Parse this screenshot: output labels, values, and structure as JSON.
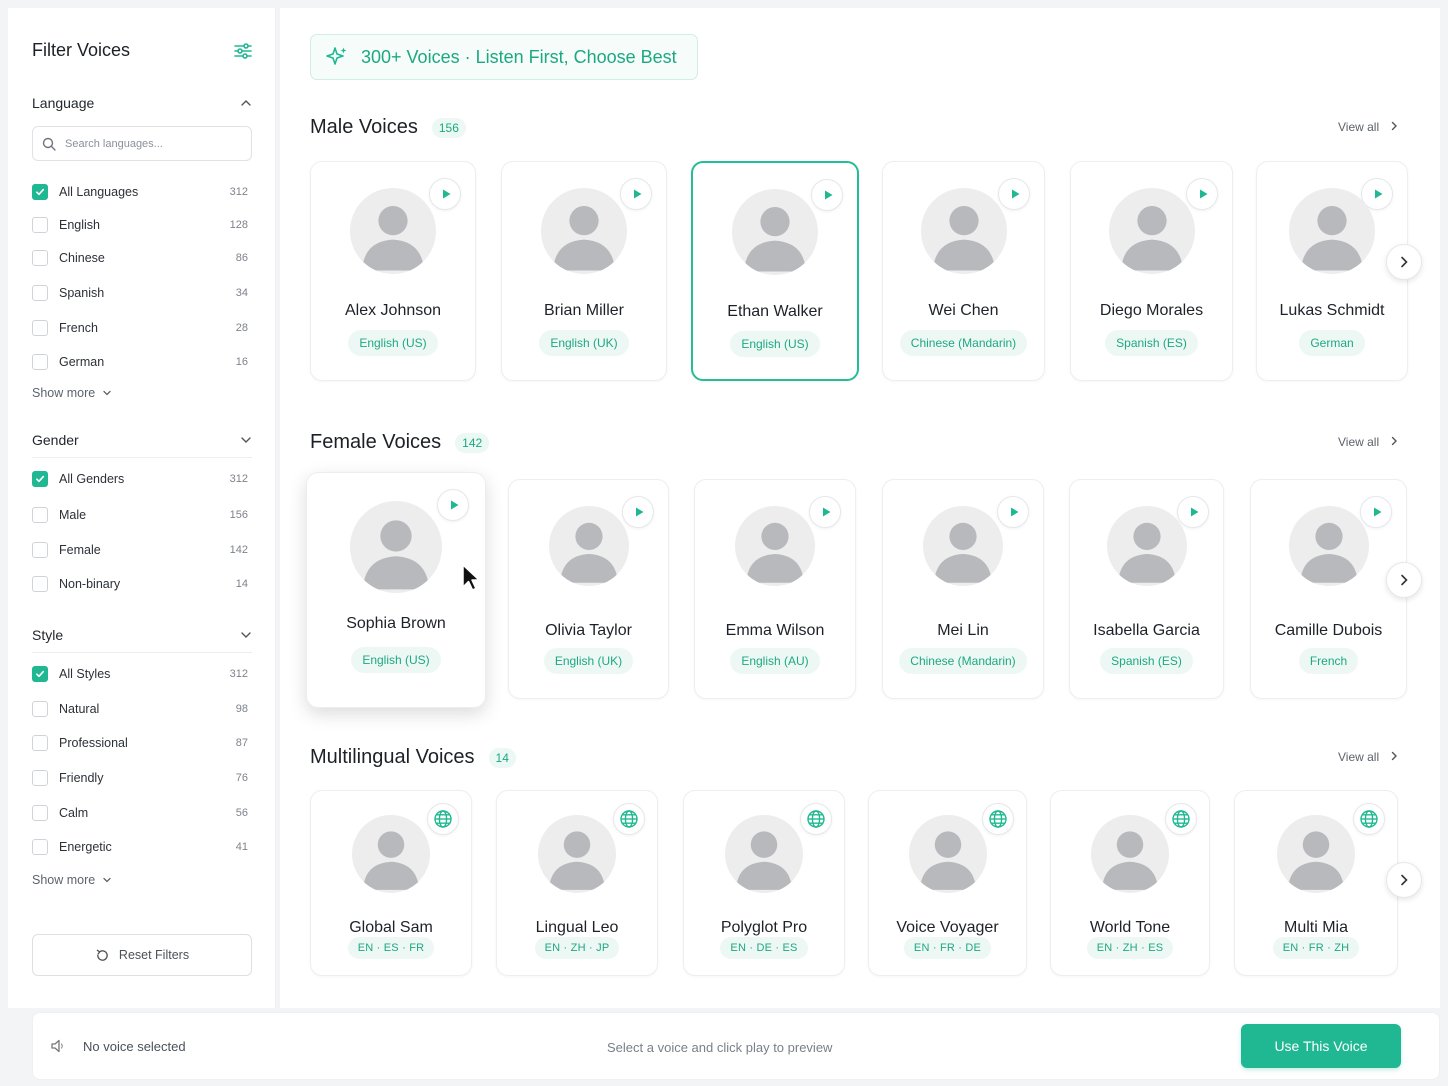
{
  "sidebar": {
    "title": "Filter Voices",
    "language": {
      "heading": "Language",
      "search_placeholder": "Search languages...",
      "options": [
        {
          "label": "All Languages",
          "count": "312",
          "checked": true
        },
        {
          "label": "English",
          "count": "128",
          "checked": false
        },
        {
          "label": "Chinese",
          "count": "86",
          "checked": false
        },
        {
          "label": "Spanish",
          "count": "34",
          "checked": false
        },
        {
          "label": "French",
          "count": "28",
          "checked": false
        },
        {
          "label": "German",
          "count": "16",
          "checked": false
        }
      ],
      "show_more": "Show more"
    },
    "gender": {
      "heading": "Gender",
      "options": [
        {
          "label": "All Genders",
          "count": "312",
          "checked": true
        },
        {
          "label": "Male",
          "count": "156",
          "checked": false
        },
        {
          "label": "Female",
          "count": "142",
          "checked": false
        },
        {
          "label": "Non-binary",
          "count": "14",
          "checked": false
        }
      ]
    },
    "style": {
      "heading": "Style",
      "options": [
        {
          "label": "All Styles",
          "count": "312",
          "checked": true
        },
        {
          "label": "Natural",
          "count": "98",
          "checked": false
        },
        {
          "label": "Professional",
          "count": "87",
          "checked": false
        },
        {
          "label": "Friendly",
          "count": "76",
          "checked": false
        },
        {
          "label": "Calm",
          "count": "56",
          "checked": false
        },
        {
          "label": "Energetic",
          "count": "41",
          "checked": false
        }
      ],
      "show_more": "Show more"
    },
    "reset_label": "Reset Filters"
  },
  "banner": {
    "text": "300+ Voices · Listen First, Choose Best",
    "icon": "sparkle-icon"
  },
  "sections": {
    "male": {
      "title": "Male Voices",
      "count": "156",
      "view_all": "View all",
      "voices": [
        {
          "name": "Alex Johnson",
          "tag": "English (US)"
        },
        {
          "name": "Brian Miller",
          "tag": "English (UK)"
        },
        {
          "name": "Ethan Walker",
          "tag": "English (US)"
        },
        {
          "name": "Wei Chen",
          "tag": "Chinese (Mandarin)"
        },
        {
          "name": "Diego Morales",
          "tag": "Spanish (ES)"
        },
        {
          "name": "Lukas Schmidt",
          "tag": "German"
        }
      ]
    },
    "female": {
      "title": "Female Voices",
      "count": "142",
      "view_all": "View all",
      "voices": [
        {
          "name": "Sophia Brown",
          "tag": "English (US)"
        },
        {
          "name": "Olivia Taylor",
          "tag": "English (UK)"
        },
        {
          "name": "Emma Wilson",
          "tag": "English (AU)"
        },
        {
          "name": "Mei Lin",
          "tag": "Chinese (Mandarin)"
        },
        {
          "name": "Isabella Garcia",
          "tag": "Spanish (ES)"
        },
        {
          "name": "Camille Dubois",
          "tag": "French"
        }
      ]
    },
    "multi": {
      "title": "Multilingual Voices",
      "count": "14",
      "view_all": "View all",
      "voices": [
        {
          "name": "Global Sam",
          "tag": "EN · ES · FR"
        },
        {
          "name": "Lingual Leo",
          "tag": "EN · ZH · JP"
        },
        {
          "name": "Polyglot Pro",
          "tag": "EN · DE · ES"
        },
        {
          "name": "Voice Voyager",
          "tag": "EN · FR · DE"
        },
        {
          "name": "World Tone",
          "tag": "EN · ZH · ES"
        },
        {
          "name": "Multi Mia",
          "tag": "EN · FR · ZH"
        }
      ]
    }
  },
  "footer": {
    "status": "No voice selected",
    "hint": "Select a voice and click play to preview",
    "cta": "Use This Voice"
  },
  "colors": {
    "accent": "#20b892",
    "accent_soft": "#edf8f4",
    "selected_border": "#25bd96"
  }
}
